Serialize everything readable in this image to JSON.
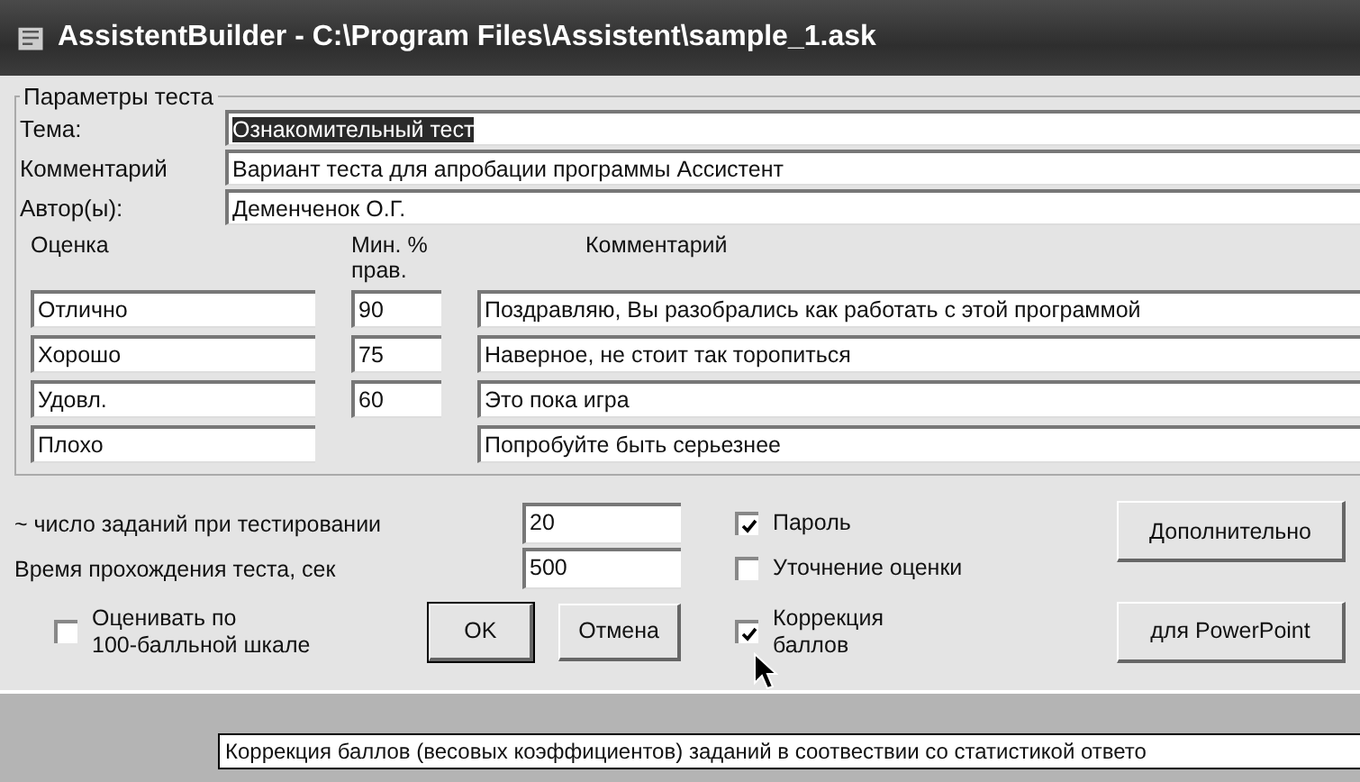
{
  "window": {
    "title": "AssistentBuilder - C:\\Program Files\\Assistent\\sample_1.ask"
  },
  "params": {
    "legend": "Параметры теста",
    "fields": [
      {
        "label": "Тема:",
        "value": "Ознакомительный тест",
        "selected": true
      },
      {
        "label": "Комментарий",
        "value": "Вариант теста для апробации программы Ассистент",
        "selected": false
      },
      {
        "label": "Автор(ы):",
        "value": "Деменченок О.Г.",
        "selected": false
      }
    ],
    "grades": {
      "columns": [
        "Оценка",
        "Мин. % прав.",
        "Комментарий"
      ],
      "rows": [
        {
          "grade": "Отлично",
          "min": "90",
          "comment": "Поздравляю, Вы разобрались как работать с  этой программой"
        },
        {
          "grade": "Хорошо",
          "min": "75",
          "comment": "Наверное, не стоит так торопиться"
        },
        {
          "grade": "Удовл.",
          "min": "60",
          "comment": "Это пока игра"
        },
        {
          "grade": "Плохо",
          "comment": "Попробуйте быть серьезнее"
        }
      ]
    }
  },
  "settings": {
    "fields": [
      {
        "label": "~ число заданий при тестировании",
        "value": "20"
      },
      {
        "label": "Время прохождения теста, сек",
        "value": "500"
      }
    ],
    "scale_checkbox": {
      "label": "Оценивать по\n100-балльной шкале",
      "checked": false
    },
    "buttons": [
      {
        "label": "OK",
        "default": true
      },
      {
        "label": "Отмена",
        "default": false
      }
    ],
    "checkboxes": [
      {
        "label": "Пароль",
        "checked": true
      },
      {
        "label": "Уточнение оценки",
        "checked": false
      },
      {
        "label": "Коррекция\nбаллов",
        "checked": true
      }
    ],
    "side_buttons": [
      "Дополнительно",
      "для PowerPoint"
    ]
  },
  "tooltip": {
    "text": "Коррекция баллов (весовых коэффициентов) заданий в соотвествии со статистикой ответо"
  }
}
